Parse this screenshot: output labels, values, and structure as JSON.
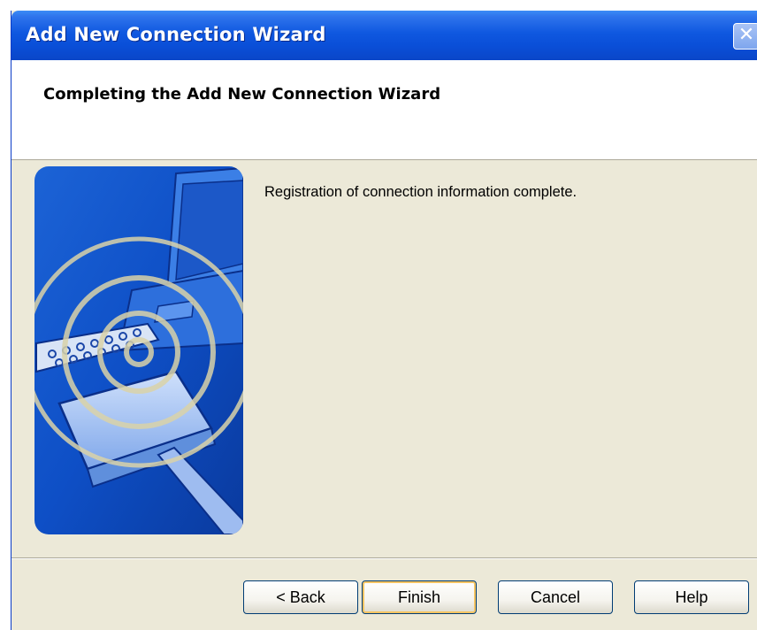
{
  "window": {
    "title": "Add New Connection Wizard",
    "close_symbol": "✕"
  },
  "header": {
    "title": "Completing the Add New Connection Wizard"
  },
  "main": {
    "message": "Registration of connection information complete.",
    "illustration": "connection-wizard-illustration"
  },
  "buttons": {
    "back": "< Back",
    "finish": "Finish",
    "cancel": "Cancel",
    "help": "Help"
  },
  "colors": {
    "titlebar": "#0a4fd8",
    "dialog_bg": "#ece9d8",
    "button_border": "#003c74",
    "default_button_highlight": "#f5c462"
  }
}
